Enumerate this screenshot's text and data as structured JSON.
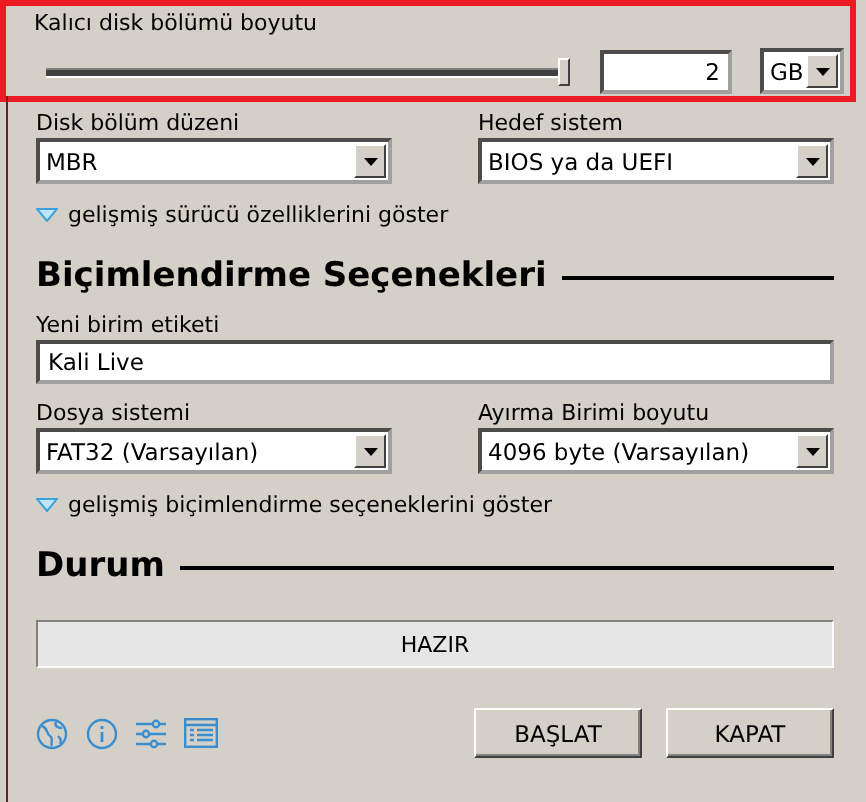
{
  "persistence": {
    "label": "Kalıcı disk bölümü boyutu",
    "level": 1,
    "value": "2",
    "unit": "GB"
  },
  "drive_fields": [
    {
      "label": "Disk bölüm düzeni",
      "value": "MBR"
    },
    {
      "label": "Hedef sistem",
      "value": "BIOS ya da UEFI"
    }
  ],
  "drive_expander": "gelişmiş sürücü özelliklerini göster",
  "format_heading": "Biçimlendirme Seçenekleri",
  "volume_label": {
    "label": "Yeni birim etiketi",
    "value": "Kali Live"
  },
  "format_fields": [
    {
      "label": "Dosya sistemi",
      "value": "FAT32 (Varsayılan)"
    },
    {
      "label": "Ayırma Birimi boyutu",
      "value": "4096 byte (Varsayılan)"
    }
  ],
  "format_expander": "gelişmiş biçimlendirme seçeneklerini göster",
  "status_heading": "Durum",
  "status": {
    "text": "HAZIR"
  },
  "buttons": [
    "BAŞLAT",
    "KAPAT"
  ]
}
